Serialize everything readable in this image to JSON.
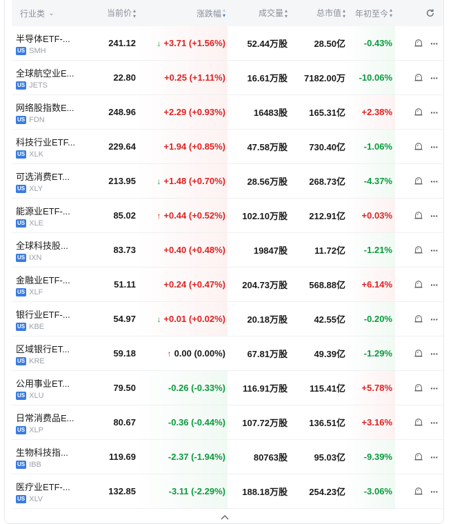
{
  "header": {
    "category": "行业类",
    "price": "当前价",
    "change": "涨跌幅",
    "volume": "成交量",
    "market_cap": "总市值",
    "ytd": "年初至今"
  },
  "colors": {
    "up": "#e02020",
    "down": "#0a9a3c",
    "badge": "#3a7be0"
  },
  "rows": [
    {
      "name": "半导体ETF-...",
      "badge": "US",
      "ticker": "SMH",
      "price": "241.12",
      "arrow": "↓",
      "change": "+3.71 (+1.56%)",
      "volume": "52.44万股",
      "cap": "28.50亿",
      "ytd": "-0.43%",
      "dir": "up",
      "ytd_dir": "down"
    },
    {
      "name": "全球航空业E...",
      "badge": "US",
      "ticker": "JETS",
      "price": "22.80",
      "arrow": "",
      "change": "+0.25 (+1.11%)",
      "volume": "16.61万股",
      "cap": "7182.00万",
      "ytd": "-10.06%",
      "dir": "up",
      "ytd_dir": "down"
    },
    {
      "name": "网络股指数E...",
      "badge": "US",
      "ticker": "FDN",
      "price": "248.96",
      "arrow": "",
      "change": "+2.29 (+0.93%)",
      "volume": "16483股",
      "cap": "165.31亿",
      "ytd": "+2.38%",
      "dir": "up",
      "ytd_dir": "up"
    },
    {
      "name": "科技行业ETF...",
      "badge": "US",
      "ticker": "XLK",
      "price": "229.64",
      "arrow": "",
      "change": "+1.94 (+0.85%)",
      "volume": "47.58万股",
      "cap": "730.40亿",
      "ytd": "-1.06%",
      "dir": "up",
      "ytd_dir": "down"
    },
    {
      "name": "可选消费ET...",
      "badge": "US",
      "ticker": "XLY",
      "price": "213.95",
      "arrow": "↓",
      "change": "+1.48 (+0.70%)",
      "volume": "28.56万股",
      "cap": "268.73亿",
      "ytd": "-4.37%",
      "dir": "up",
      "ytd_dir": "down"
    },
    {
      "name": "能源业ETF-...",
      "badge": "US",
      "ticker": "XLE",
      "price": "85.02",
      "arrow": "↑",
      "change": "+0.44 (+0.52%)",
      "volume": "102.10万股",
      "cap": "212.91亿",
      "ytd": "+0.03%",
      "dir": "up",
      "ytd_dir": "up"
    },
    {
      "name": "全球科技股...",
      "badge": "US",
      "ticker": "IXN",
      "price": "83.73",
      "arrow": "",
      "change": "+0.40 (+0.48%)",
      "volume": "19847股",
      "cap": "11.72亿",
      "ytd": "-1.21%",
      "dir": "up",
      "ytd_dir": "down"
    },
    {
      "name": "金融业ETF-...",
      "badge": "US",
      "ticker": "XLF",
      "price": "51.11",
      "arrow": "",
      "change": "+0.24 (+0.47%)",
      "volume": "204.73万股",
      "cap": "568.88亿",
      "ytd": "+6.14%",
      "dir": "up",
      "ytd_dir": "up"
    },
    {
      "name": "银行业ETF-...",
      "badge": "US",
      "ticker": "KBE",
      "price": "54.97",
      "arrow": "↓",
      "change": "+0.01 (+0.02%)",
      "volume": "20.18万股",
      "cap": "42.55亿",
      "ytd": "-0.20%",
      "dir": "up",
      "ytd_dir": "down"
    },
    {
      "name": "区域银行ET...",
      "badge": "US",
      "ticker": "KRE",
      "price": "59.18",
      "arrow": "↑",
      "change": "0.00 (0.00%)",
      "volume": "67.81万股",
      "cap": "49.39亿",
      "ytd": "-1.29%",
      "dir": "neu",
      "ytd_dir": "down"
    },
    {
      "name": "公用事业ET...",
      "badge": "US",
      "ticker": "XLU",
      "price": "79.50",
      "arrow": "",
      "change": "-0.26 (-0.33%)",
      "volume": "116.91万股",
      "cap": "115.41亿",
      "ytd": "+5.78%",
      "dir": "down",
      "ytd_dir": "up"
    },
    {
      "name": "日常消费品E...",
      "badge": "US",
      "ticker": "XLP",
      "price": "80.67",
      "arrow": "",
      "change": "-0.36 (-0.44%)",
      "volume": "107.72万股",
      "cap": "136.51亿",
      "ytd": "+3.16%",
      "dir": "down",
      "ytd_dir": "up"
    },
    {
      "name": "生物科技指...",
      "badge": "US",
      "ticker": "IBB",
      "price": "119.69",
      "arrow": "",
      "change": "-2.37 (-1.94%)",
      "volume": "80763股",
      "cap": "95.03亿",
      "ytd": "-9.39%",
      "dir": "down",
      "ytd_dir": "down"
    },
    {
      "name": "医疗业ETF-...",
      "badge": "US",
      "ticker": "XLV",
      "price": "132.85",
      "arrow": "",
      "change": "-3.11 (-2.29%)",
      "volume": "188.18万股",
      "cap": "254.23亿",
      "ytd": "-3.06%",
      "dir": "down",
      "ytd_dir": "down"
    }
  ]
}
